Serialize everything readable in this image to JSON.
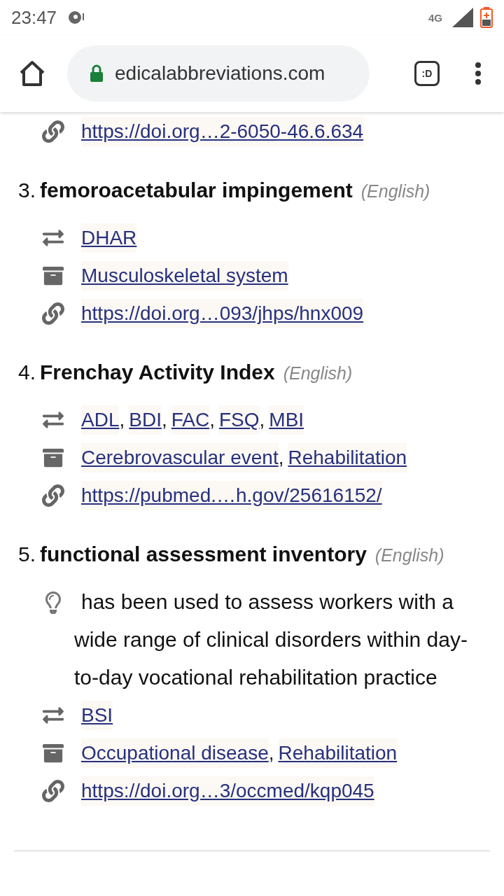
{
  "status_bar": {
    "time": "23:47",
    "network": "4G"
  },
  "browser": {
    "url": "edicalabbreviations.com",
    "tab_switcher": ":D"
  },
  "continued_lines": [
    {
      "kind": "link",
      "links": [
        "https://doi.org…2-6050-46.6.634"
      ]
    }
  ],
  "entries": [
    {
      "number": "3.",
      "title": "femoroacetabular impingement",
      "language": "(English)",
      "lines": [
        {
          "kind": "synonyms",
          "links": [
            "DHAR"
          ]
        },
        {
          "kind": "categories",
          "links": [
            "Musculoskeletal system"
          ]
        },
        {
          "kind": "link",
          "links": [
            "https://doi.org…093/jhps/hnx009"
          ]
        }
      ]
    },
    {
      "number": "4.",
      "title": "Frenchay Activity Index",
      "language": "(English)",
      "lines": [
        {
          "kind": "synonyms",
          "separator": ",",
          "links": [
            "ADL",
            "BDI",
            "FAC",
            "FSQ",
            "MBI"
          ]
        },
        {
          "kind": "categories",
          "separator": ",",
          "links": [
            "Cerebrovascular event",
            "Rehabilitation"
          ]
        },
        {
          "kind": "link",
          "links": [
            "https://pubmed.…h.gov/25616152/"
          ]
        }
      ]
    },
    {
      "number": "5.",
      "title": "functional assessment inventory",
      "language": "(English)",
      "lines": [
        {
          "kind": "note",
          "text": "has been used to assess workers with a wide range of clinical disorders within day-to-day vocational rehabilitation practice"
        },
        {
          "kind": "synonyms",
          "links": [
            "BSI"
          ]
        },
        {
          "kind": "categories",
          "separator": ",",
          "links": [
            "Occupational disease",
            "Rehabilitation"
          ]
        },
        {
          "kind": "link",
          "links": [
            "https://doi.org…3/occmed/kqp045"
          ]
        }
      ]
    }
  ]
}
